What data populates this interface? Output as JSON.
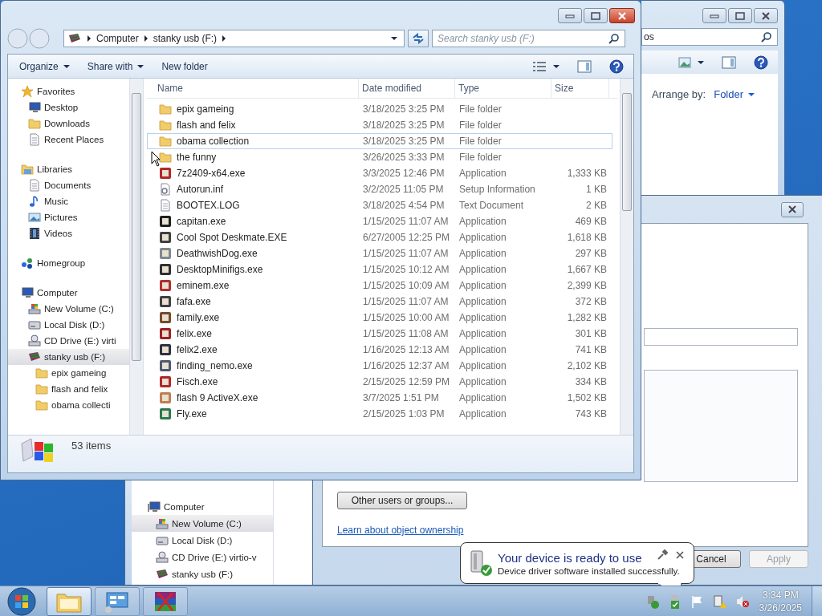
{
  "explorer": {
    "breadcrumb": [
      "Computer",
      "stanky usb (F:)"
    ],
    "search": {
      "placeholder": "Search stanky usb (F:)"
    },
    "toolbar": [
      {
        "label": "Organize",
        "dropdown": true
      },
      {
        "label": "Share with",
        "dropdown": true
      },
      {
        "label": "New folder",
        "dropdown": false
      }
    ],
    "nav": [
      {
        "label": "Favorites",
        "kind": "star",
        "selected": false,
        "children": [
          {
            "label": "Desktop",
            "kind": "screen",
            "selected": false
          },
          {
            "label": "Downloads",
            "kind": "folder",
            "selected": false
          },
          {
            "label": "Recent Places",
            "kind": "recent",
            "selected": false
          }
        ]
      },
      {
        "label": "Libraries",
        "kind": "library",
        "selected": false,
        "children": [
          {
            "label": "Documents",
            "kind": "document",
            "selected": false
          },
          {
            "label": "Music",
            "kind": "music",
            "selected": false
          },
          {
            "label": "Pictures",
            "kind": "picture",
            "selected": false
          },
          {
            "label": "Videos",
            "kind": "video",
            "selected": false
          }
        ]
      },
      {
        "label": "Homegroup",
        "kind": "homegroup",
        "selected": false
      },
      {
        "label": "Computer",
        "kind": "computer",
        "selected": false,
        "children": [
          {
            "label": "New Volume (C:)",
            "kind": "system-drive",
            "selected": false
          },
          {
            "label": "Local Disk (D:)",
            "kind": "drive",
            "selected": false
          },
          {
            "label": "CD Drive (E:) virti",
            "kind": "disc",
            "selected": false
          },
          {
            "label": "stanky usb (F:)",
            "kind": "usb",
            "selected": true,
            "children": [
              {
                "label": "epix gameing",
                "kind": "folder",
                "selected": false
              },
              {
                "label": "flash and felix",
                "kind": "folder",
                "selected": false
              },
              {
                "label": "obama collecti",
                "kind": "folder",
                "selected": false
              }
            ]
          }
        ]
      }
    ],
    "columns": [
      "Name",
      "Date modified",
      "Type",
      "Size"
    ],
    "rows": [
      {
        "name": "epix gameing",
        "date": "3/18/2025 3:25 PM",
        "type": "File folder",
        "kind": "folder",
        "focused": false
      },
      {
        "name": "flash and felix",
        "date": "3/18/2025 3:25 PM",
        "type": "File folder",
        "kind": "folder",
        "focused": false
      },
      {
        "name": "obama collection",
        "date": "3/18/2025 3:25 PM",
        "type": "File folder",
        "kind": "folder",
        "focused": true
      },
      {
        "name": "the funny",
        "date": "3/26/2025 3:33 PM",
        "type": "File folder",
        "kind": "folder",
        "focused": false
      },
      {
        "name": "7z2409-x64.exe",
        "date": "3/3/2025 12:46 PM",
        "type": "Application",
        "size": "1,333 KB",
        "kind": "program",
        "focused": false
      },
      {
        "name": "Autorun.inf",
        "date": "3/2/2025 11:05 PM",
        "type": "Setup Information",
        "size": "1 KB",
        "kind": "settings",
        "focused": false
      },
      {
        "name": "BOOTEX.LOG",
        "date": "3/18/2025 4:54 PM",
        "type": "Text Document",
        "size": "2 KB",
        "kind": "text",
        "focused": false
      },
      {
        "name": "capitan.exe",
        "date": "1/15/2025 11:07 AM",
        "type": "Application",
        "size": "469 KB",
        "kind": "program",
        "focused": false
      },
      {
        "name": "Cool Spot Deskmate.EXE",
        "date": "6/27/2005 12:25 PM",
        "type": "Application",
        "size": "1,618 KB",
        "kind": "program",
        "focused": false
      },
      {
        "name": "DeathwishDog.exe",
        "date": "1/15/2025 11:07 AM",
        "type": "Application",
        "size": "297 KB",
        "kind": "program",
        "focused": false
      },
      {
        "name": "DesktopMinifigs.exe",
        "date": "1/15/2025 10:12 AM",
        "type": "Application",
        "size": "1,667 KB",
        "kind": "program",
        "focused": false
      },
      {
        "name": "eminem.exe",
        "date": "1/15/2025 10:09 AM",
        "type": "Application",
        "size": "2,399 KB",
        "kind": "program",
        "focused": false
      },
      {
        "name": "fafa.exe",
        "date": "1/15/2025 11:07 AM",
        "type": "Application",
        "size": "372 KB",
        "kind": "program",
        "focused": false
      },
      {
        "name": "family.exe",
        "date": "1/15/2025 10:00 AM",
        "type": "Application",
        "size": "1,282 KB",
        "kind": "program",
        "focused": false
      },
      {
        "name": "felix.exe",
        "date": "1/15/2025 11:08 AM",
        "type": "Application",
        "size": "301 KB",
        "kind": "program",
        "focused": false
      },
      {
        "name": "felix2.exe",
        "date": "1/16/2025 12:13 AM",
        "type": "Application",
        "size": "741 KB",
        "kind": "program",
        "focused": false
      },
      {
        "name": "finding_nemo.exe",
        "date": "1/16/2025 12:37 AM",
        "type": "Application",
        "size": "2,102 KB",
        "kind": "program",
        "focused": false
      },
      {
        "name": "Fisch.exe",
        "date": "2/15/2025 12:59 PM",
        "type": "Application",
        "size": "334 KB",
        "kind": "program",
        "focused": false
      },
      {
        "name": "flash 9 ActiveX.exe",
        "date": "3/7/2025 1:51 PM",
        "type": "Application",
        "size": "1,502 KB",
        "kind": "program",
        "focused": false
      },
      {
        "name": "Fly.exe",
        "date": "2/15/2025 1:03 PM",
        "type": "Application",
        "size": "743 KB",
        "kind": "program",
        "focused": false
      }
    ],
    "status": "53 items"
  },
  "back_explorer": {
    "search": {
      "value": "os"
    },
    "arrange_label": "Arrange by:",
    "arrange_value": "Folder"
  },
  "lower_explorer": {
    "nav": [
      {
        "label": "Computer",
        "kind": "computer",
        "selected": false,
        "children": [
          {
            "label": "New Volume (C:)",
            "kind": "system-drive",
            "selected": true
          },
          {
            "label": "Local Disk (D:)",
            "kind": "drive",
            "selected": false
          },
          {
            "label": "CD Drive (E:) virtio-v",
            "kind": "disc",
            "selected": false
          },
          {
            "label": "stanky usb (F:)",
            "kind": "usb",
            "selected": false
          }
        ]
      }
    ]
  },
  "properties_dialog": {
    "owner_button": "Other users or groups...",
    "link": "Learn about object ownership",
    "buttons": [
      {
        "label": "Cancel",
        "disabled": false
      },
      {
        "label": "Apply",
        "disabled": true
      }
    ]
  },
  "notification": {
    "title": "Your device is ready to use",
    "message": "Device driver software installed successfully."
  },
  "taskbar": {
    "buttons": [
      {
        "kind": "explorer",
        "active": true
      },
      {
        "kind": "control-panel",
        "active": false
      },
      {
        "kind": "archive",
        "active": false
      }
    ],
    "clock": {
      "time": "3:34 PM",
      "date": "3/26/2025"
    }
  }
}
